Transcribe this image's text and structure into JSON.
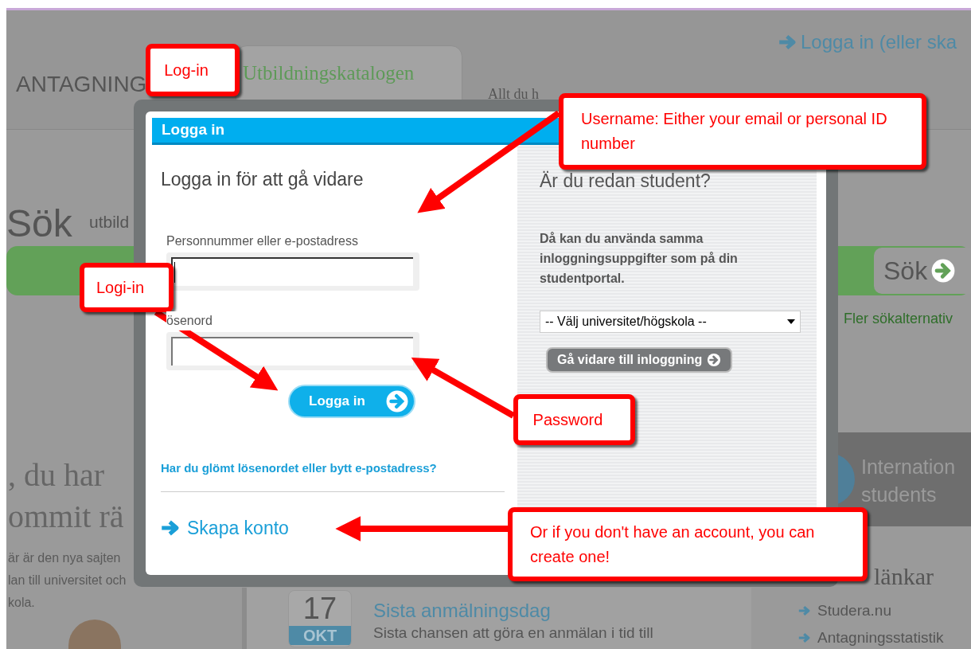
{
  "background_page": {
    "brand": "ANTAGNING",
    "catalog_tab": "Utbildningskatalogen",
    "catalog_subtitle": "Allt du h",
    "login_link": "Logga in (eller ska",
    "search_title": "Sök",
    "search_subtitle": "utbild",
    "search_button": "Sök",
    "more_search_options": "Fler sökalternativ",
    "headline": [
      ", du har",
      "ommit rä"
    ],
    "intro": [
      "är är den nya sajten",
      "lan till universitet och",
      "kola."
    ],
    "deadline": {
      "day": "17",
      "month": "OKT",
      "title": "Sista anmälningsdag",
      "text": "Sista chansen att göra en anmälan i tid till"
    },
    "international": [
      "Internation",
      "students"
    ],
    "links_title": "länkar",
    "links": [
      "Studera.nu",
      "Antagningsstatistik"
    ]
  },
  "dialog": {
    "title": "Logga in",
    "left": {
      "heading": "Logga in för att gå vidare",
      "fields": [
        {
          "label": "Personnummer eller e-postadress",
          "focused": true
        },
        {
          "label": "ösenord",
          "focused": false
        }
      ],
      "submit": "Logga in",
      "forgot_link": "Har du glömt lösenordet eller bytt e-postadress?",
      "create_account": "Skapa konto"
    },
    "right": {
      "heading": "Är du redan student?",
      "text": "Då kan du använda samma inloggningsuppgifter som på din studentportal.",
      "select_value": "-- Välj universitet/högskola --",
      "continue_button": "Gå vidare till inloggning"
    }
  },
  "annotations": [
    {
      "text": "Log-in"
    },
    {
      "text": "Username: Either your email or personal ID number"
    },
    {
      "text": "Logi-in"
    },
    {
      "text": "Password"
    },
    {
      "text": "Or if you don't have an account, you can create one!"
    }
  ]
}
